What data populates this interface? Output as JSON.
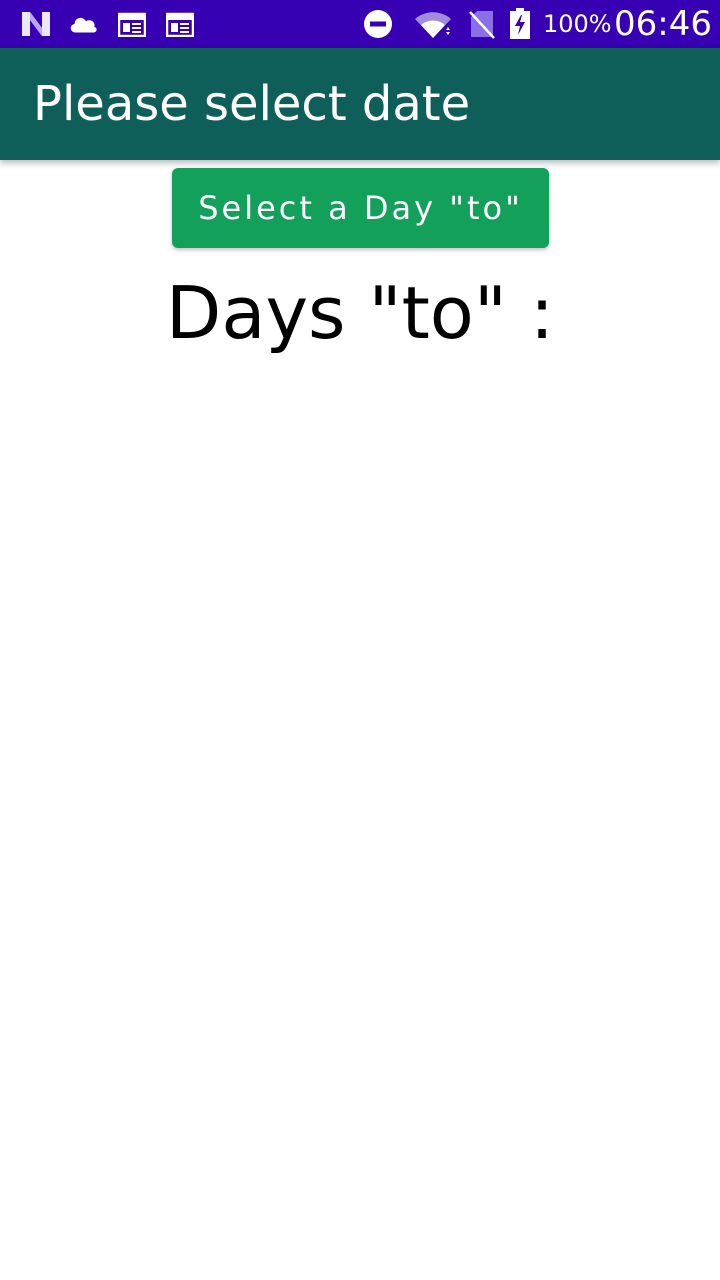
{
  "status_bar": {
    "icons_left": [
      "n-logo-icon",
      "cloud-icon",
      "calendar-icon",
      "calendar-icon"
    ],
    "icons_right": [
      "do-not-disturb-icon",
      "wifi-icon",
      "no-sim-icon",
      "battery-charging-icon"
    ],
    "battery_percent": "100%",
    "time": "06:46",
    "color": "#3700b3"
  },
  "app_bar": {
    "title": "Please select date",
    "color": "#0e5e5a"
  },
  "main": {
    "select_button_label": "Select a Day \"to\"",
    "button_color": "#13a05a",
    "days_label": "Days \"to\" :"
  }
}
